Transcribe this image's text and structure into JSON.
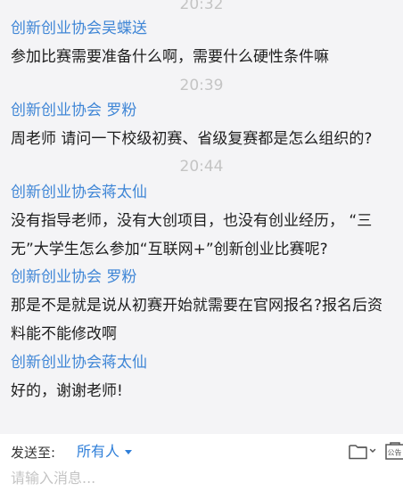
{
  "chat": {
    "times": [
      "20:32",
      "20:39",
      "20:44"
    ],
    "senders": [
      "创新创业协会吴蝶送",
      "创新创业协会 罗粉",
      "创新创业协会蒋太仙",
      "创新创业协会 罗粉",
      "创新创业协会蒋太仙"
    ],
    "lines": [
      "参加比赛需要准备什么啊，需要什么硬性条件嘛",
      "周老师  请问一下校级初赛、省级复赛都是怎么组织的?",
      "没有指导老师，没有大创项目，也没有创业经历，  “三",
      "无”大学生怎么参加“互联网+”创新创业比赛呢?",
      "那是不是就是说从初赛开始就需要在官网报名?报名后资",
      "料能不能修改啊",
      "好的，谢谢老师!"
    ]
  },
  "compose": {
    "send_to_label": "发送至:",
    "recipient": "所有人",
    "announce_label": "公告",
    "input_placeholder": "请输入消息..."
  },
  "icons": {
    "folder": "folder-icon",
    "dropdown": "chevron-down-icon",
    "announcement": "announcement-icon"
  },
  "colors": {
    "sender_name": "#3f86d6",
    "timestamp": "#c4c4c4",
    "chat_background": "#f4f4f6",
    "compose_background": "#ffffff"
  }
}
